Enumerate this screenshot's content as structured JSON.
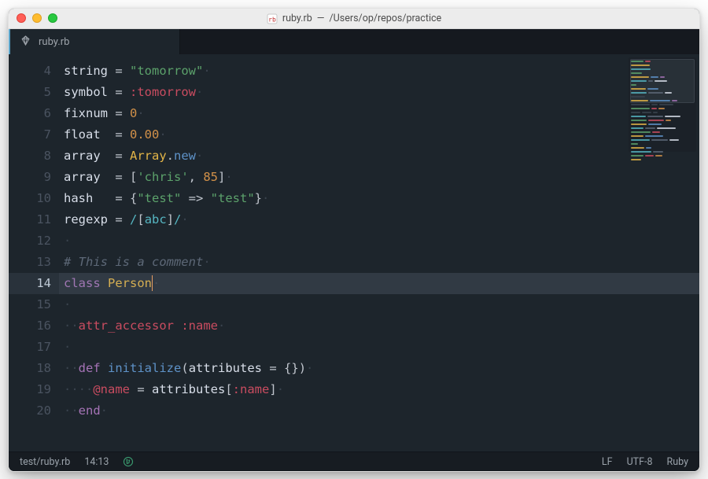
{
  "titlebar": {
    "filename": "ruby.rb",
    "separator": " — ",
    "path": "/Users/op/repos/practice"
  },
  "tab": {
    "label": "ruby.rb"
  },
  "gutter": {
    "start": 4,
    "end": 20,
    "active": 14
  },
  "code": {
    "lines": [
      {
        "n": 4,
        "tokens": [
          [
            "c-var",
            "string"
          ],
          [
            "c-op",
            " = "
          ],
          [
            "c-str",
            "\"tomorrow\""
          ]
        ]
      },
      {
        "n": 5,
        "tokens": [
          [
            "c-var",
            "symbol"
          ],
          [
            "c-op",
            " = "
          ],
          [
            "c-symbol",
            ":tomorrow"
          ]
        ]
      },
      {
        "n": 6,
        "tokens": [
          [
            "c-var",
            "fixnum"
          ],
          [
            "c-op",
            " = "
          ],
          [
            "c-num",
            "0"
          ]
        ]
      },
      {
        "n": 7,
        "tokens": [
          [
            "c-var",
            "float "
          ],
          [
            "c-op",
            " = "
          ],
          [
            "c-num",
            "0.00"
          ]
        ]
      },
      {
        "n": 8,
        "tokens": [
          [
            "c-var",
            "array "
          ],
          [
            "c-op",
            " = "
          ],
          [
            "c-type",
            "Array"
          ],
          [
            "c-punct",
            "."
          ],
          [
            "c-method",
            "new"
          ]
        ]
      },
      {
        "n": 9,
        "tokens": [
          [
            "c-var",
            "array "
          ],
          [
            "c-op",
            " = "
          ],
          [
            "c-punct",
            "["
          ],
          [
            "c-str",
            "'chris'"
          ],
          [
            "c-punct",
            ", "
          ],
          [
            "c-num",
            "85"
          ],
          [
            "c-punct",
            "]"
          ]
        ]
      },
      {
        "n": 10,
        "tokens": [
          [
            "c-var",
            "hash  "
          ],
          [
            "c-op",
            " = "
          ],
          [
            "c-punct",
            "{"
          ],
          [
            "c-str",
            "\"test\""
          ],
          [
            "c-op",
            " => "
          ],
          [
            "c-str",
            "\"test\""
          ],
          [
            "c-punct",
            "}"
          ]
        ]
      },
      {
        "n": 11,
        "tokens": [
          [
            "c-var",
            "regexp"
          ],
          [
            "c-op",
            " = "
          ],
          [
            "c-regex",
            "/"
          ],
          [
            "c-punct",
            "["
          ],
          [
            "c-regex",
            "abc"
          ],
          [
            "c-punct",
            "]"
          ],
          [
            "c-regex",
            "/"
          ]
        ]
      },
      {
        "n": 12,
        "tokens": []
      },
      {
        "n": 13,
        "tokens": [
          [
            "c-comment",
            "# This is a comment"
          ]
        ]
      },
      {
        "n": 14,
        "tokens": [
          [
            "c-kw",
            "class"
          ],
          [
            "c-var",
            " "
          ],
          [
            "c-type",
            "Person"
          ]
        ],
        "cursor": true
      },
      {
        "n": 15,
        "tokens": []
      },
      {
        "n": 16,
        "indent": 1,
        "tokens": [
          [
            "c-attr",
            "attr_accessor"
          ],
          [
            "c-var",
            " "
          ],
          [
            "c-symbol",
            ":name"
          ]
        ]
      },
      {
        "n": 17,
        "tokens": []
      },
      {
        "n": 18,
        "indent": 1,
        "tokens": [
          [
            "c-kw",
            "def"
          ],
          [
            "c-var",
            " "
          ],
          [
            "c-method",
            "initialize"
          ],
          [
            "c-paren",
            "("
          ],
          [
            "c-var",
            "attributes"
          ],
          [
            "c-op",
            " = "
          ],
          [
            "c-punct",
            "{}"
          ],
          [
            "c-paren",
            ")"
          ]
        ]
      },
      {
        "n": 19,
        "indent": 2,
        "tokens": [
          [
            "c-ivar",
            "@name"
          ],
          [
            "c-op",
            " = "
          ],
          [
            "c-var",
            "attributes"
          ],
          [
            "c-punct",
            "["
          ],
          [
            "c-symbol",
            ":name"
          ],
          [
            "c-punct",
            "]"
          ]
        ]
      },
      {
        "n": 20,
        "indent": 1,
        "tokens": [
          [
            "c-kw",
            "end"
          ]
        ]
      }
    ]
  },
  "statusbar": {
    "path": "test/ruby.rb",
    "position": "14:13",
    "line_ending": "LF",
    "encoding": "UTF-8",
    "language": "Ruby"
  },
  "minimap_colors": [
    "#5ca26b",
    "#c94c60",
    "#d29149",
    "#e2b447",
    "#5e92c8",
    "#a573b6",
    "#56b6c2",
    "#5d6877",
    "#d8dee9"
  ]
}
